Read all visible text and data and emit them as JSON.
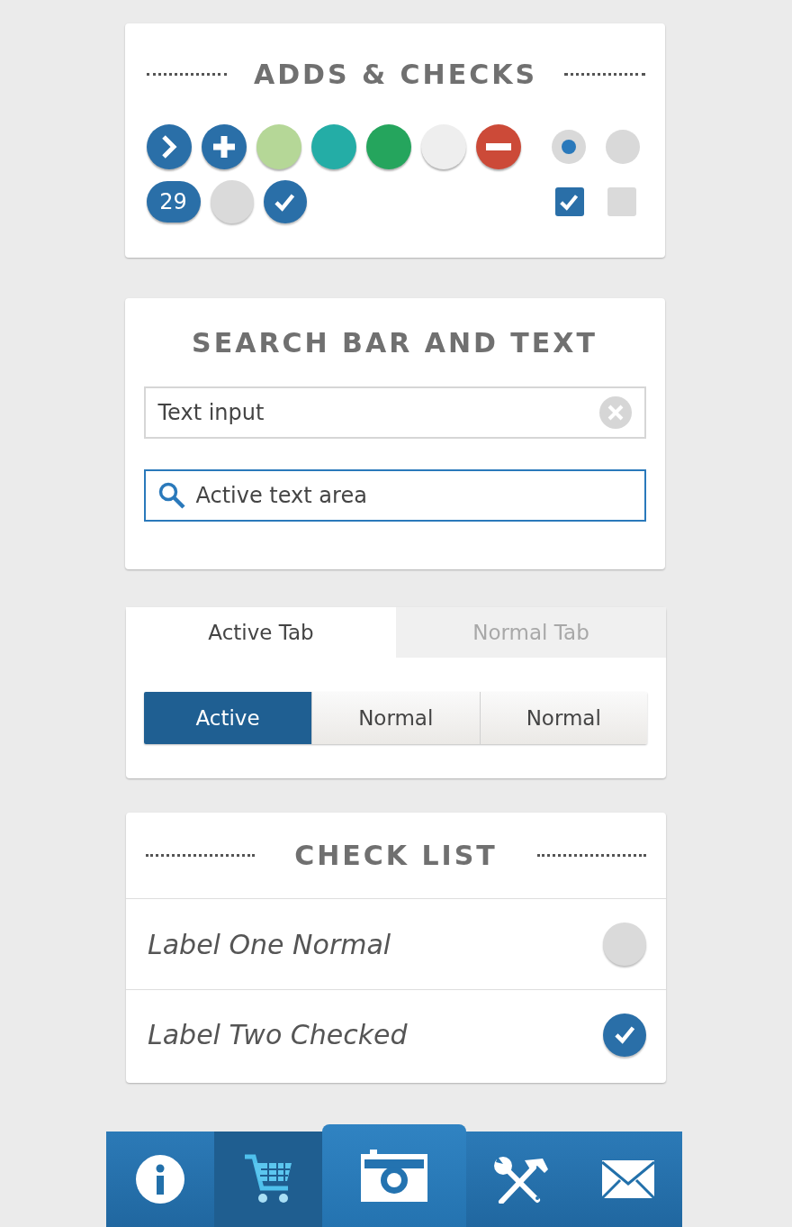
{
  "adds_checks": {
    "title": "ADDS & CHECKS",
    "round_buttons": [
      {
        "kind": "arrow",
        "color": "#2a6fa8"
      },
      {
        "kind": "plus",
        "color": "#2a6fa8"
      },
      {
        "kind": "plain",
        "color": "#b5d797"
      },
      {
        "kind": "plain",
        "color": "#24ada6"
      },
      {
        "kind": "plain",
        "color": "#25a55d"
      },
      {
        "kind": "plain",
        "color": "#eeeeee"
      },
      {
        "kind": "minus",
        "color": "#cc4a38"
      }
    ],
    "radios": [
      {
        "selected": true
      },
      {
        "selected": false
      }
    ],
    "badge": "29",
    "round_checks": [
      {
        "checked": false
      },
      {
        "checked": true
      }
    ],
    "checkboxes": [
      {
        "checked": true
      },
      {
        "checked": false
      }
    ]
  },
  "search": {
    "title": "SEARCH BAR AND TEXT",
    "text_input": {
      "value": "Text input",
      "active": false
    },
    "search_input": {
      "value": "Active text area",
      "active": true
    }
  },
  "tabs_card": {
    "tabs": [
      {
        "label": "Active Tab",
        "selected": true
      },
      {
        "label": "Normal Tab",
        "selected": false
      }
    ],
    "segments": [
      {
        "label": "Active",
        "selected": true
      },
      {
        "label": "Normal",
        "selected": false
      },
      {
        "label": "Normal",
        "selected": false
      }
    ]
  },
  "check_list": {
    "title": "CHECK LIST",
    "items": [
      {
        "label": "Label One Normal",
        "checked": false
      },
      {
        "label": "Label Two Checked",
        "checked": true
      }
    ]
  },
  "tab_bar": {
    "items": [
      {
        "kind": "info",
        "selected": false,
        "raised": false
      },
      {
        "kind": "cart",
        "selected": true,
        "raised": false
      },
      {
        "kind": "camera",
        "selected": false,
        "raised": true
      },
      {
        "kind": "tools",
        "selected": false,
        "raised": false
      },
      {
        "kind": "mail",
        "selected": false,
        "raised": false
      }
    ]
  }
}
